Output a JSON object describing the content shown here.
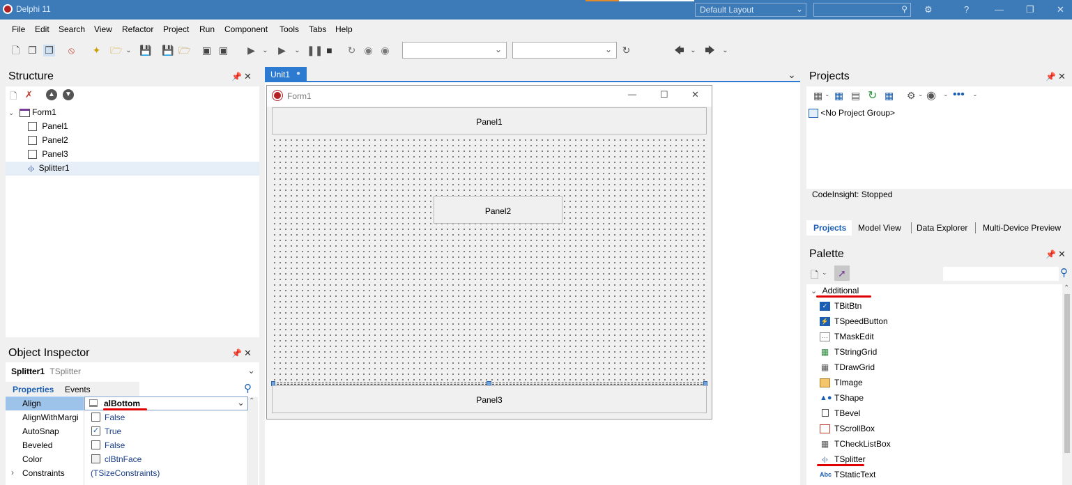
{
  "titlebar": {
    "title": "Delphi 11",
    "layout": "Default Layout",
    "help": "?"
  },
  "menu": [
    "File",
    "Edit",
    "Search",
    "View",
    "Refactor",
    "Project",
    "Run",
    "Component",
    "Tools",
    "Tabs",
    "Help"
  ],
  "structure": {
    "title": "Structure",
    "items": [
      "Form1",
      "Panel1",
      "Panel2",
      "Panel3",
      "Splitter1"
    ]
  },
  "object_inspector": {
    "title": "Object Inspector",
    "selected_name": "Splitter1",
    "selected_type": "TSplitter",
    "tabs": [
      "Properties",
      "Events"
    ],
    "properties": [
      {
        "name": "Align",
        "value": "alBottom"
      },
      {
        "name": "AlignWithMargi",
        "value": "False"
      },
      {
        "name": "AutoSnap",
        "value": "True"
      },
      {
        "name": "Beveled",
        "value": "False"
      },
      {
        "name": "Color",
        "value": "clBtnFace"
      },
      {
        "name": "Constraints",
        "value": "(TSizeConstraints)"
      }
    ]
  },
  "designer": {
    "tab": "Unit1",
    "form_caption": "Form1",
    "panel1": "Panel1",
    "panel2": "Panel2",
    "panel3": "Panel3"
  },
  "projects": {
    "title": "Projects",
    "group": "<No Project Group>",
    "status": "CodeInsight: Stopped",
    "tabs": [
      "Projects",
      "Model View",
      "Data Explorer",
      "Multi-Device Preview"
    ]
  },
  "palette": {
    "title": "Palette",
    "category": "Additional",
    "items": [
      "TBitBtn",
      "TSpeedButton",
      "TMaskEdit",
      "TStringGrid",
      "TDrawGrid",
      "TImage",
      "TShape",
      "TBevel",
      "TScrollBox",
      "TCheckListBox",
      "TSplitter",
      "TStaticText"
    ],
    "icon_abc": "Abc"
  },
  "colors": {
    "titlebar": "#3d7ab8",
    "tab_active": "#2d7bd1",
    "link_blue": "#1a3f8a",
    "annotation_red": "#e00000"
  }
}
